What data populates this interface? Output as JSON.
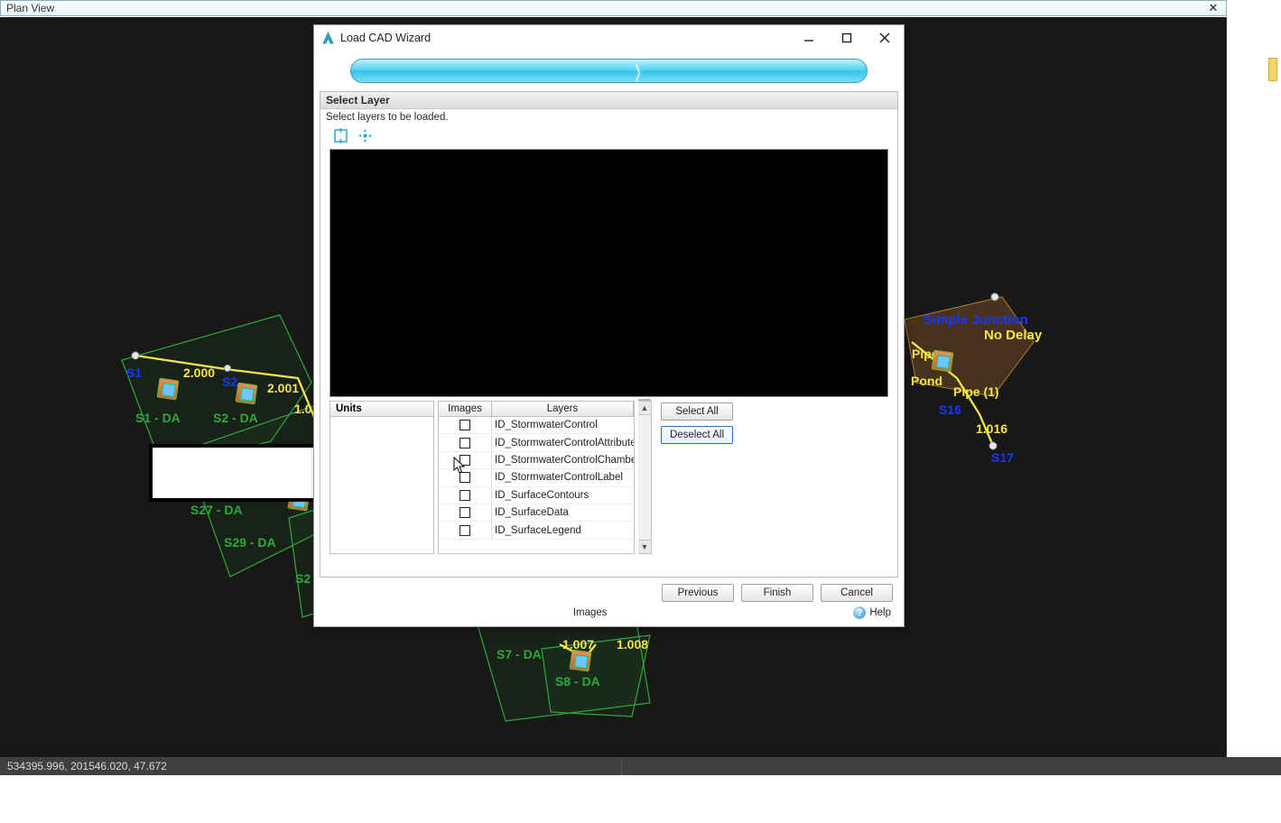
{
  "planview": {
    "title": "Plan View"
  },
  "statusbar": {
    "coords": "534395.996, 201546.020, 47.672"
  },
  "canvas": {
    "labels": {
      "s1": "S1",
      "l2000": "2.000",
      "l2001": "2.001",
      "s1da": "S1 - DA",
      "s2da": "S2 - DA",
      "l10": "1.0",
      "s27da": "S27 - DA",
      "s29da": "S29 - DA",
      "s2x": "S2",
      "l1007": "1.007",
      "l1008": "1.008",
      "s7da": "S7 - DA",
      "s8da": "S8 - DA",
      "simpleJunction": "Simple Junction",
      "noDelay": "No Delay",
      "pipe": "Pipe",
      "pond": "Pond",
      "pipe1": "Pipe (1)",
      "s16": "S16",
      "l1016": "1.016",
      "s17": "S17",
      "s29hidden": "S29 - D"
    }
  },
  "dialog": {
    "title": "Load CAD Wizard",
    "section_header": "Select Layer",
    "section_sub": "Select layers to be loaded.",
    "units_header": "Units",
    "col_images": "Images",
    "col_layers": "Layers",
    "rows": [
      {
        "layer": "ID_StormwaterControl"
      },
      {
        "layer": "ID_StormwaterControlAttributes"
      },
      {
        "layer": "ID_StormwaterControlChambers"
      },
      {
        "layer": "ID_StormwaterControlLabel"
      },
      {
        "layer": "ID_SurfaceContours"
      },
      {
        "layer": "ID_SurfaceData"
      },
      {
        "layer": "ID_SurfaceLegend"
      }
    ],
    "select_all": "Select All",
    "deselect_all": "Deselect All",
    "previous": "Previous",
    "finish": "Finish",
    "cancel": "Cancel",
    "status_center": "Images",
    "help": "Help"
  }
}
